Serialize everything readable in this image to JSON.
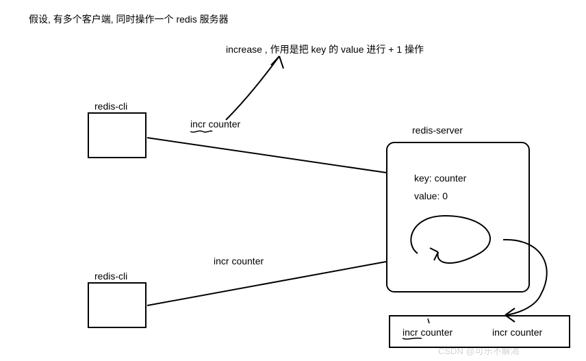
{
  "title": "假设, 有多个客户端, 同时操作一个 redis 服务器",
  "annotation": "increase , 作用是把 key 的 value 进行 + 1 操作",
  "client1_label": "redis-cli",
  "client2_label": "redis-cli",
  "server_label": "redis-server",
  "key_text": "key: counter",
  "value_text": "value: 0",
  "cmd1": "incr counter",
  "cmd2": "incr counter",
  "queue_cmd1": "incr counter",
  "queue_cmd2": "incr counter",
  "watermark": "CSDN @可乐不解渴"
}
